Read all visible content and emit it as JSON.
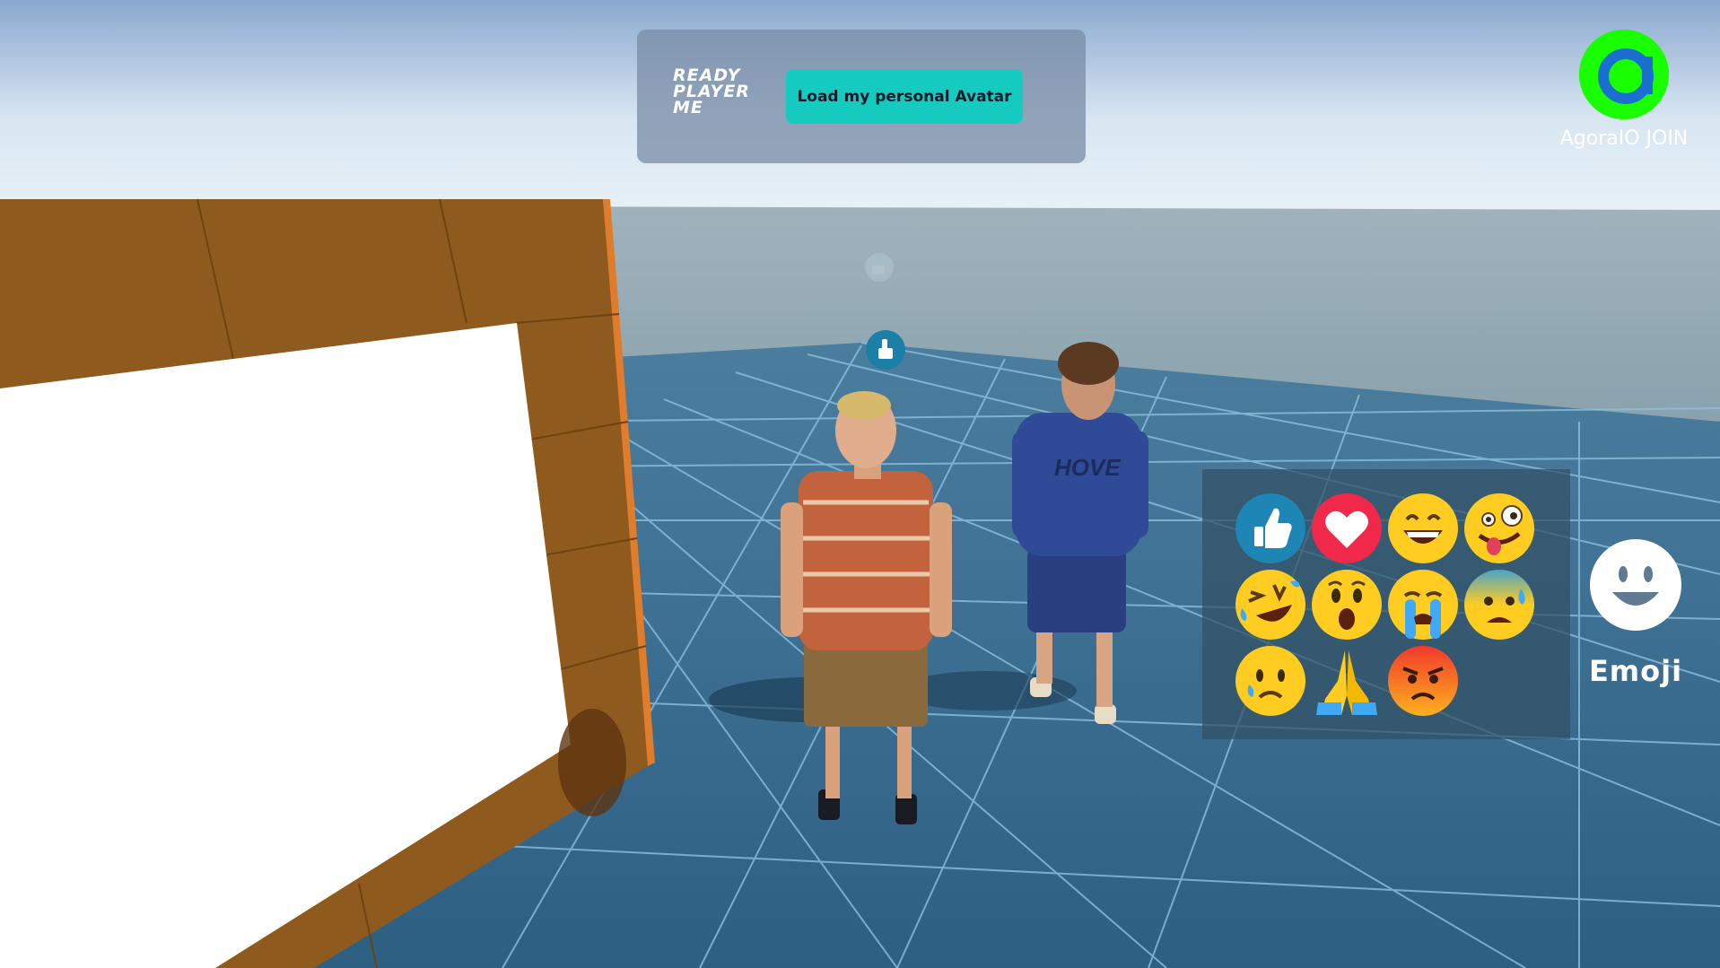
{
  "scene": {
    "sky_color": "#a9c3dc",
    "floor_color": "#3d6f92",
    "wall_color": "#8f5a1d",
    "reaction_icon": "thumbs-up-icon"
  },
  "ready_player_me": {
    "logo_lines": [
      "READY",
      "PLAYER",
      "ME"
    ],
    "load_button_label": "Load my personal Avatar",
    "accent": "#15cbc0"
  },
  "agora": {
    "logo_icon": "agora-logo-icon",
    "label": "AgoraIO JOIN",
    "accent": "#1aff00"
  },
  "emoji_panel": {
    "items": [
      {
        "name": "thumbs-up",
        "icon": "thumbs-up-icon"
      },
      {
        "name": "heart",
        "icon": "heart-icon"
      },
      {
        "name": "grinning",
        "icon": "grinning-face-icon"
      },
      {
        "name": "zany",
        "icon": "zany-face-icon"
      },
      {
        "name": "laughing-tears",
        "icon": "rolling-laughing-face-icon"
      },
      {
        "name": "surprised",
        "icon": "astonished-face-icon"
      },
      {
        "name": "crying",
        "icon": "loudly-crying-face-icon"
      },
      {
        "name": "anxious",
        "icon": "anxious-sweat-face-icon"
      },
      {
        "name": "sad",
        "icon": "slightly-frowning-face-icon"
      },
      {
        "name": "pray",
        "icon": "folded-hands-icon"
      },
      {
        "name": "angry",
        "icon": "angry-face-icon"
      }
    ]
  },
  "emoji_toggle": {
    "label": "Emoji",
    "icon": "smiley-face-icon"
  }
}
